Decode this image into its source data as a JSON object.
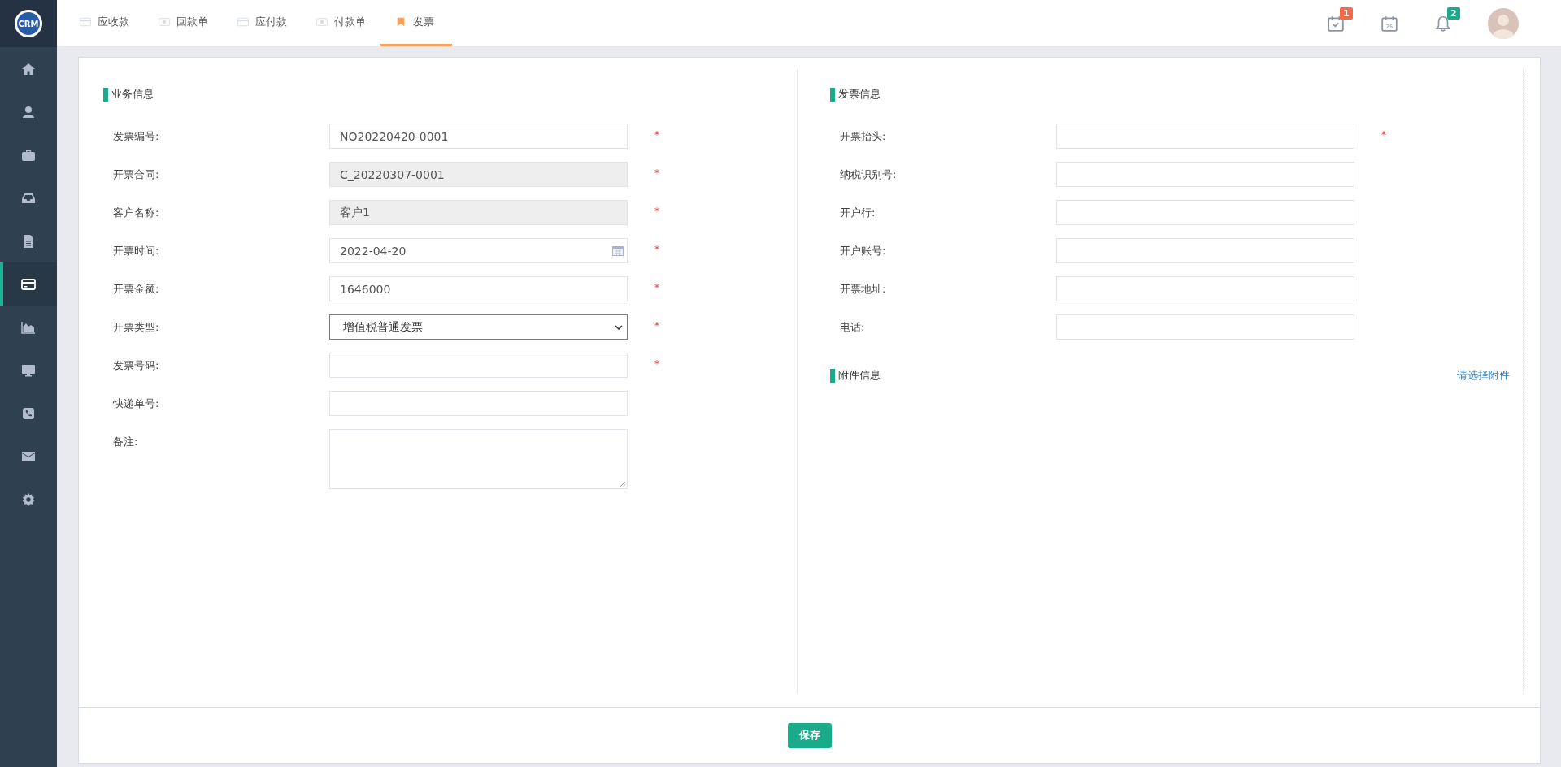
{
  "sidebar": {
    "logo": "CRM",
    "items": [
      {
        "selected": false
      },
      {
        "selected": false
      },
      {
        "selected": false
      },
      {
        "selected": false
      },
      {
        "selected": false
      },
      {
        "selected": true
      },
      {
        "selected": false
      },
      {
        "selected": false
      },
      {
        "selected": false
      },
      {
        "selected": false
      },
      {
        "selected": false
      }
    ]
  },
  "tabs": [
    {
      "label": "应收款",
      "selected": false
    },
    {
      "label": "回款单",
      "selected": false
    },
    {
      "label": "应付款",
      "selected": false
    },
    {
      "label": "付款单",
      "selected": false
    },
    {
      "label": "发票",
      "selected": true
    }
  ],
  "toolbar": [
    {
      "kind": "task",
      "badge": "1",
      "color": "#f26b4b"
    },
    {
      "kind": "calendar",
      "day": "25"
    },
    {
      "kind": "bell",
      "badge": "2",
      "color": "#1aab8a"
    },
    {
      "kind": "avatar"
    }
  ],
  "business_info": {
    "title": "业务信息",
    "fields": [
      {
        "label": "发票编号:",
        "kind": "text",
        "value": "NO20220420-0001",
        "disabled": false,
        "focused": false,
        "mark": "*"
      },
      {
        "label": "开票合同:",
        "kind": "text",
        "value": "C_20220307-0001",
        "disabled": true,
        "focused": false,
        "mark": "*"
      },
      {
        "label": "客户名称:",
        "kind": "text",
        "value": "客户1",
        "disabled": true,
        "focused": false,
        "mark": "*"
      },
      {
        "label": "开票时间:",
        "kind": "date",
        "value": "2022-04-20",
        "disabled": false,
        "focused": false,
        "mark": "*"
      },
      {
        "label": "开票金额:",
        "kind": "text",
        "value": "1646000",
        "disabled": false,
        "focused": false,
        "mark": "*"
      },
      {
        "label": "开票类型:",
        "kind": "select",
        "value": "增值税普通发票",
        "disabled": false,
        "focused": true,
        "mark": "*"
      },
      {
        "label": "发票号码:",
        "kind": "text",
        "disabled": false,
        "focused": false,
        "mark": "*"
      },
      {
        "label": "快递单号:",
        "kind": "text",
        "disabled": false,
        "focused": false
      },
      {
        "label": "备注:",
        "kind": "textarea",
        "disabled": false,
        "focused": false
      }
    ]
  },
  "invoice_info": {
    "title": "发票信息",
    "fields": [
      {
        "label": "开票抬头:",
        "disabled": false,
        "focused": false,
        "mark": "*"
      },
      {
        "label": "纳税识别号:",
        "disabled": false,
        "focused": false
      },
      {
        "label": "开户行:",
        "disabled": false,
        "focused": false
      },
      {
        "label": "开户账号:",
        "disabled": false,
        "focused": false
      },
      {
        "label": "开票地址:",
        "disabled": false,
        "focused": false
      },
      {
        "label": "电话:",
        "disabled": false,
        "focused": false
      }
    ]
  },
  "attachments": {
    "title": "附件信息",
    "link": "请选择附件"
  },
  "save_button": "保存"
}
